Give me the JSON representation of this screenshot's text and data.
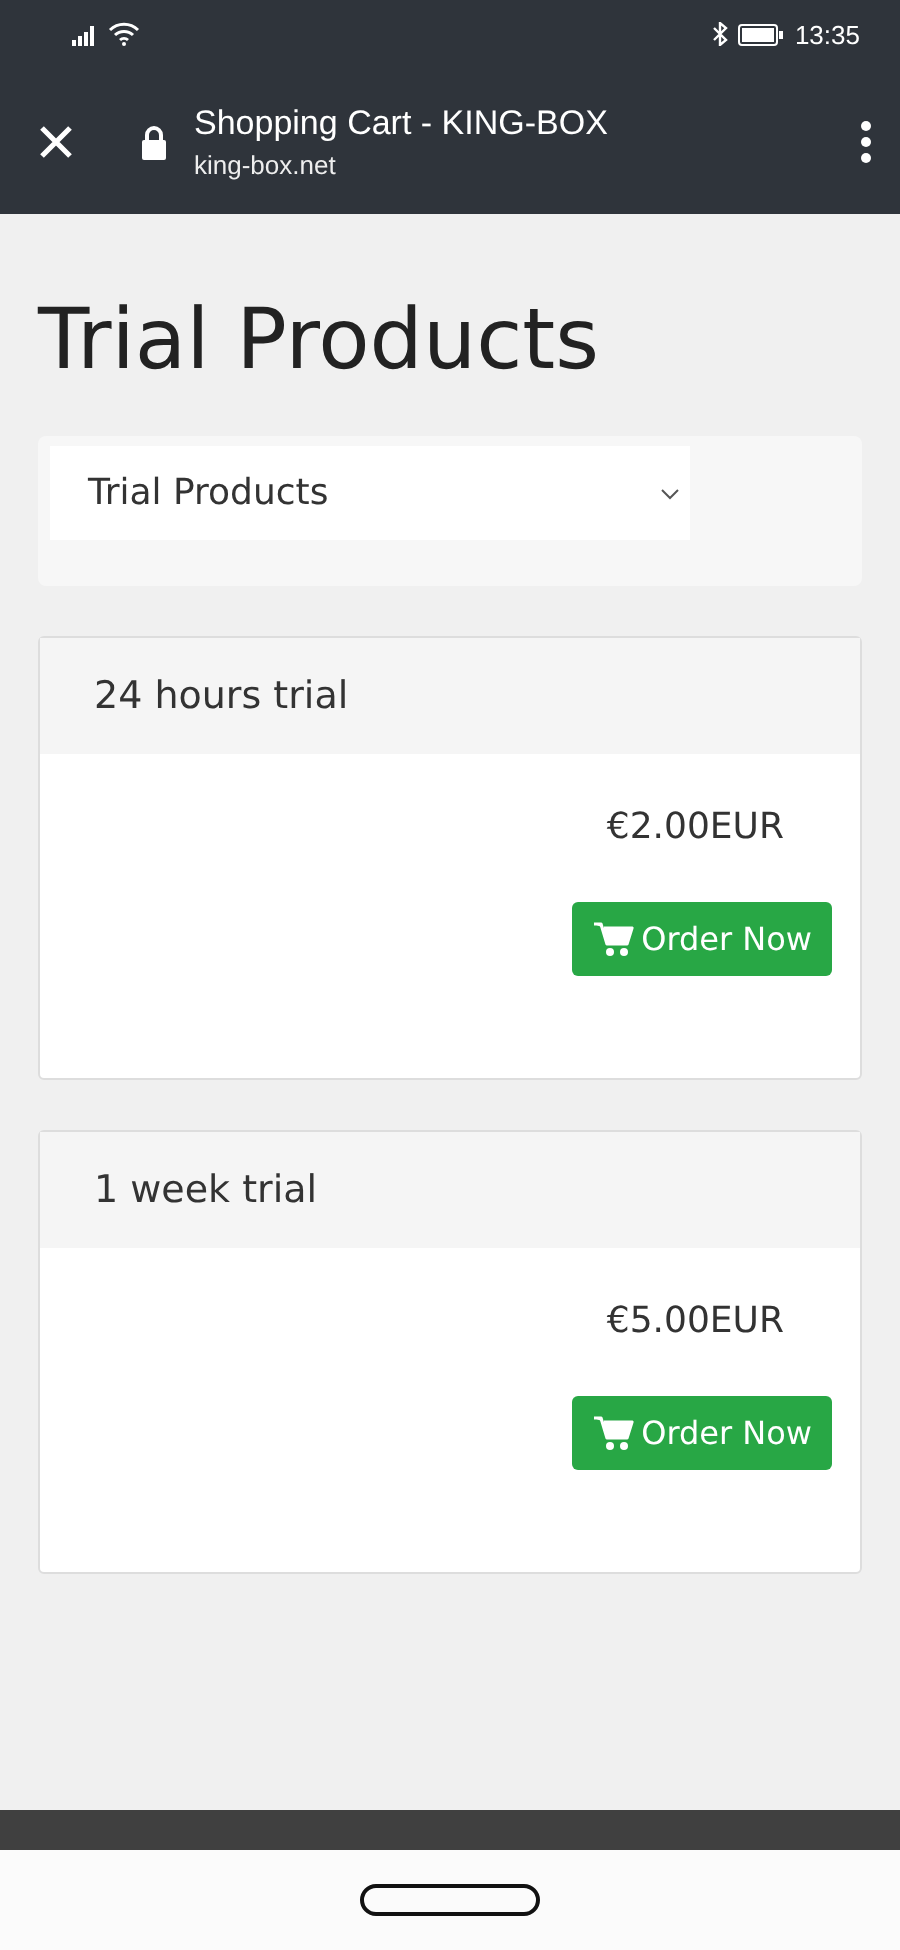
{
  "status_bar": {
    "time": "13:35"
  },
  "browser": {
    "title": "Shopping Cart - KING-BOX",
    "url": "king-box.net"
  },
  "page": {
    "heading": "Trial Products",
    "category_select": {
      "value": "Trial Products"
    }
  },
  "products": [
    {
      "name": "24 hours trial",
      "price": "€2.00EUR",
      "button": "Order Now"
    },
    {
      "name": "1 week trial",
      "price": "€5.00EUR",
      "button": "Order Now"
    }
  ]
}
